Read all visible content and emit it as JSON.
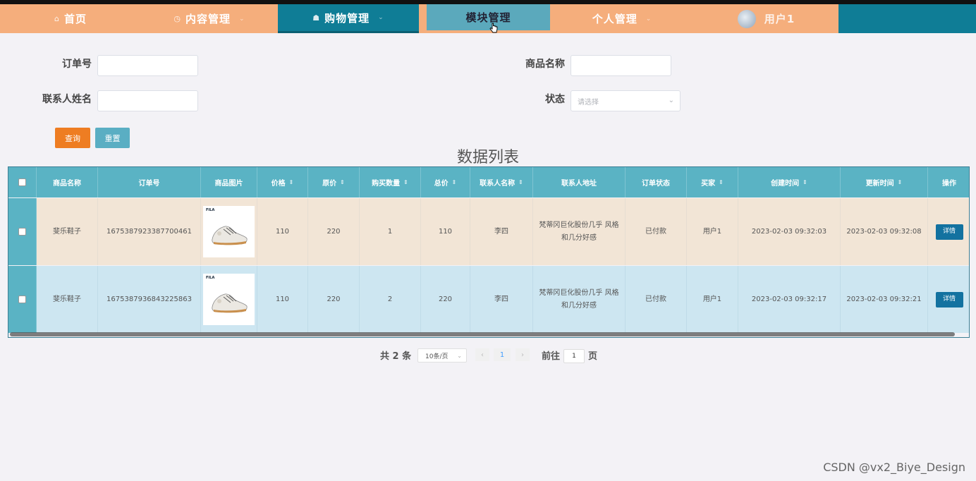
{
  "nav": {
    "home": "首页",
    "content": "内容管理",
    "shopping": "购物管理",
    "module": "模块管理",
    "personal": "个人管理",
    "user": "用户1"
  },
  "search": {
    "order_no_label": "订单号",
    "order_no_value": "",
    "product_name_label": "商品名称",
    "product_name_value": "",
    "contact_name_label": "联系人姓名",
    "contact_name_value": "",
    "status_label": "状态",
    "status_placeholder": "请选择",
    "query_button": "查询",
    "reset_button": "重置"
  },
  "table": {
    "title": "数据列表",
    "columns": [
      "商品名称",
      "订单号",
      "商品图片",
      "价格",
      "原价",
      "购买数量",
      "总价",
      "联系人名称",
      "联系人地址",
      "订单状态",
      "买家",
      "创建时间",
      "更新时间",
      "操作"
    ],
    "rows": [
      {
        "product": "斐乐鞋子",
        "order_no": "1675387923387700461",
        "brand": "FILA",
        "price": "110",
        "original_price": "220",
        "quantity": "1",
        "total": "110",
        "contact": "李四",
        "address": "梵蒂冈巨化股份几乎 风格和几分好感",
        "status": "已付款",
        "buyer": "用户1",
        "created": "2023-02-03 09:32:03",
        "updated": "2023-02-03 09:32:08",
        "action": "详情"
      },
      {
        "product": "斐乐鞋子",
        "order_no": "1675387936843225863",
        "brand": "FILA",
        "price": "110",
        "original_price": "220",
        "quantity": "2",
        "total": "220",
        "contact": "李四",
        "address": "梵蒂冈巨化股份几乎 风格和几分好感",
        "status": "已付款",
        "buyer": "用户1",
        "created": "2023-02-03 09:32:17",
        "updated": "2023-02-03 09:32:21",
        "action": "详情"
      }
    ]
  },
  "pagination": {
    "total_prefix": "共",
    "total": "2",
    "total_suffix": "条",
    "page_size": "10条/页",
    "current_page": "1",
    "goto_label": "前往",
    "goto_value": "1",
    "goto_suffix": "页"
  },
  "watermark": "CSDN @vx2_Biye_Design",
  "colors": {
    "nav_teal": "#0f7d96",
    "nav_peach": "#f5ae7c",
    "header_teal": "#5ab3c4",
    "query_orange": "#ee7d22",
    "detail_blue": "#1372a0"
  }
}
